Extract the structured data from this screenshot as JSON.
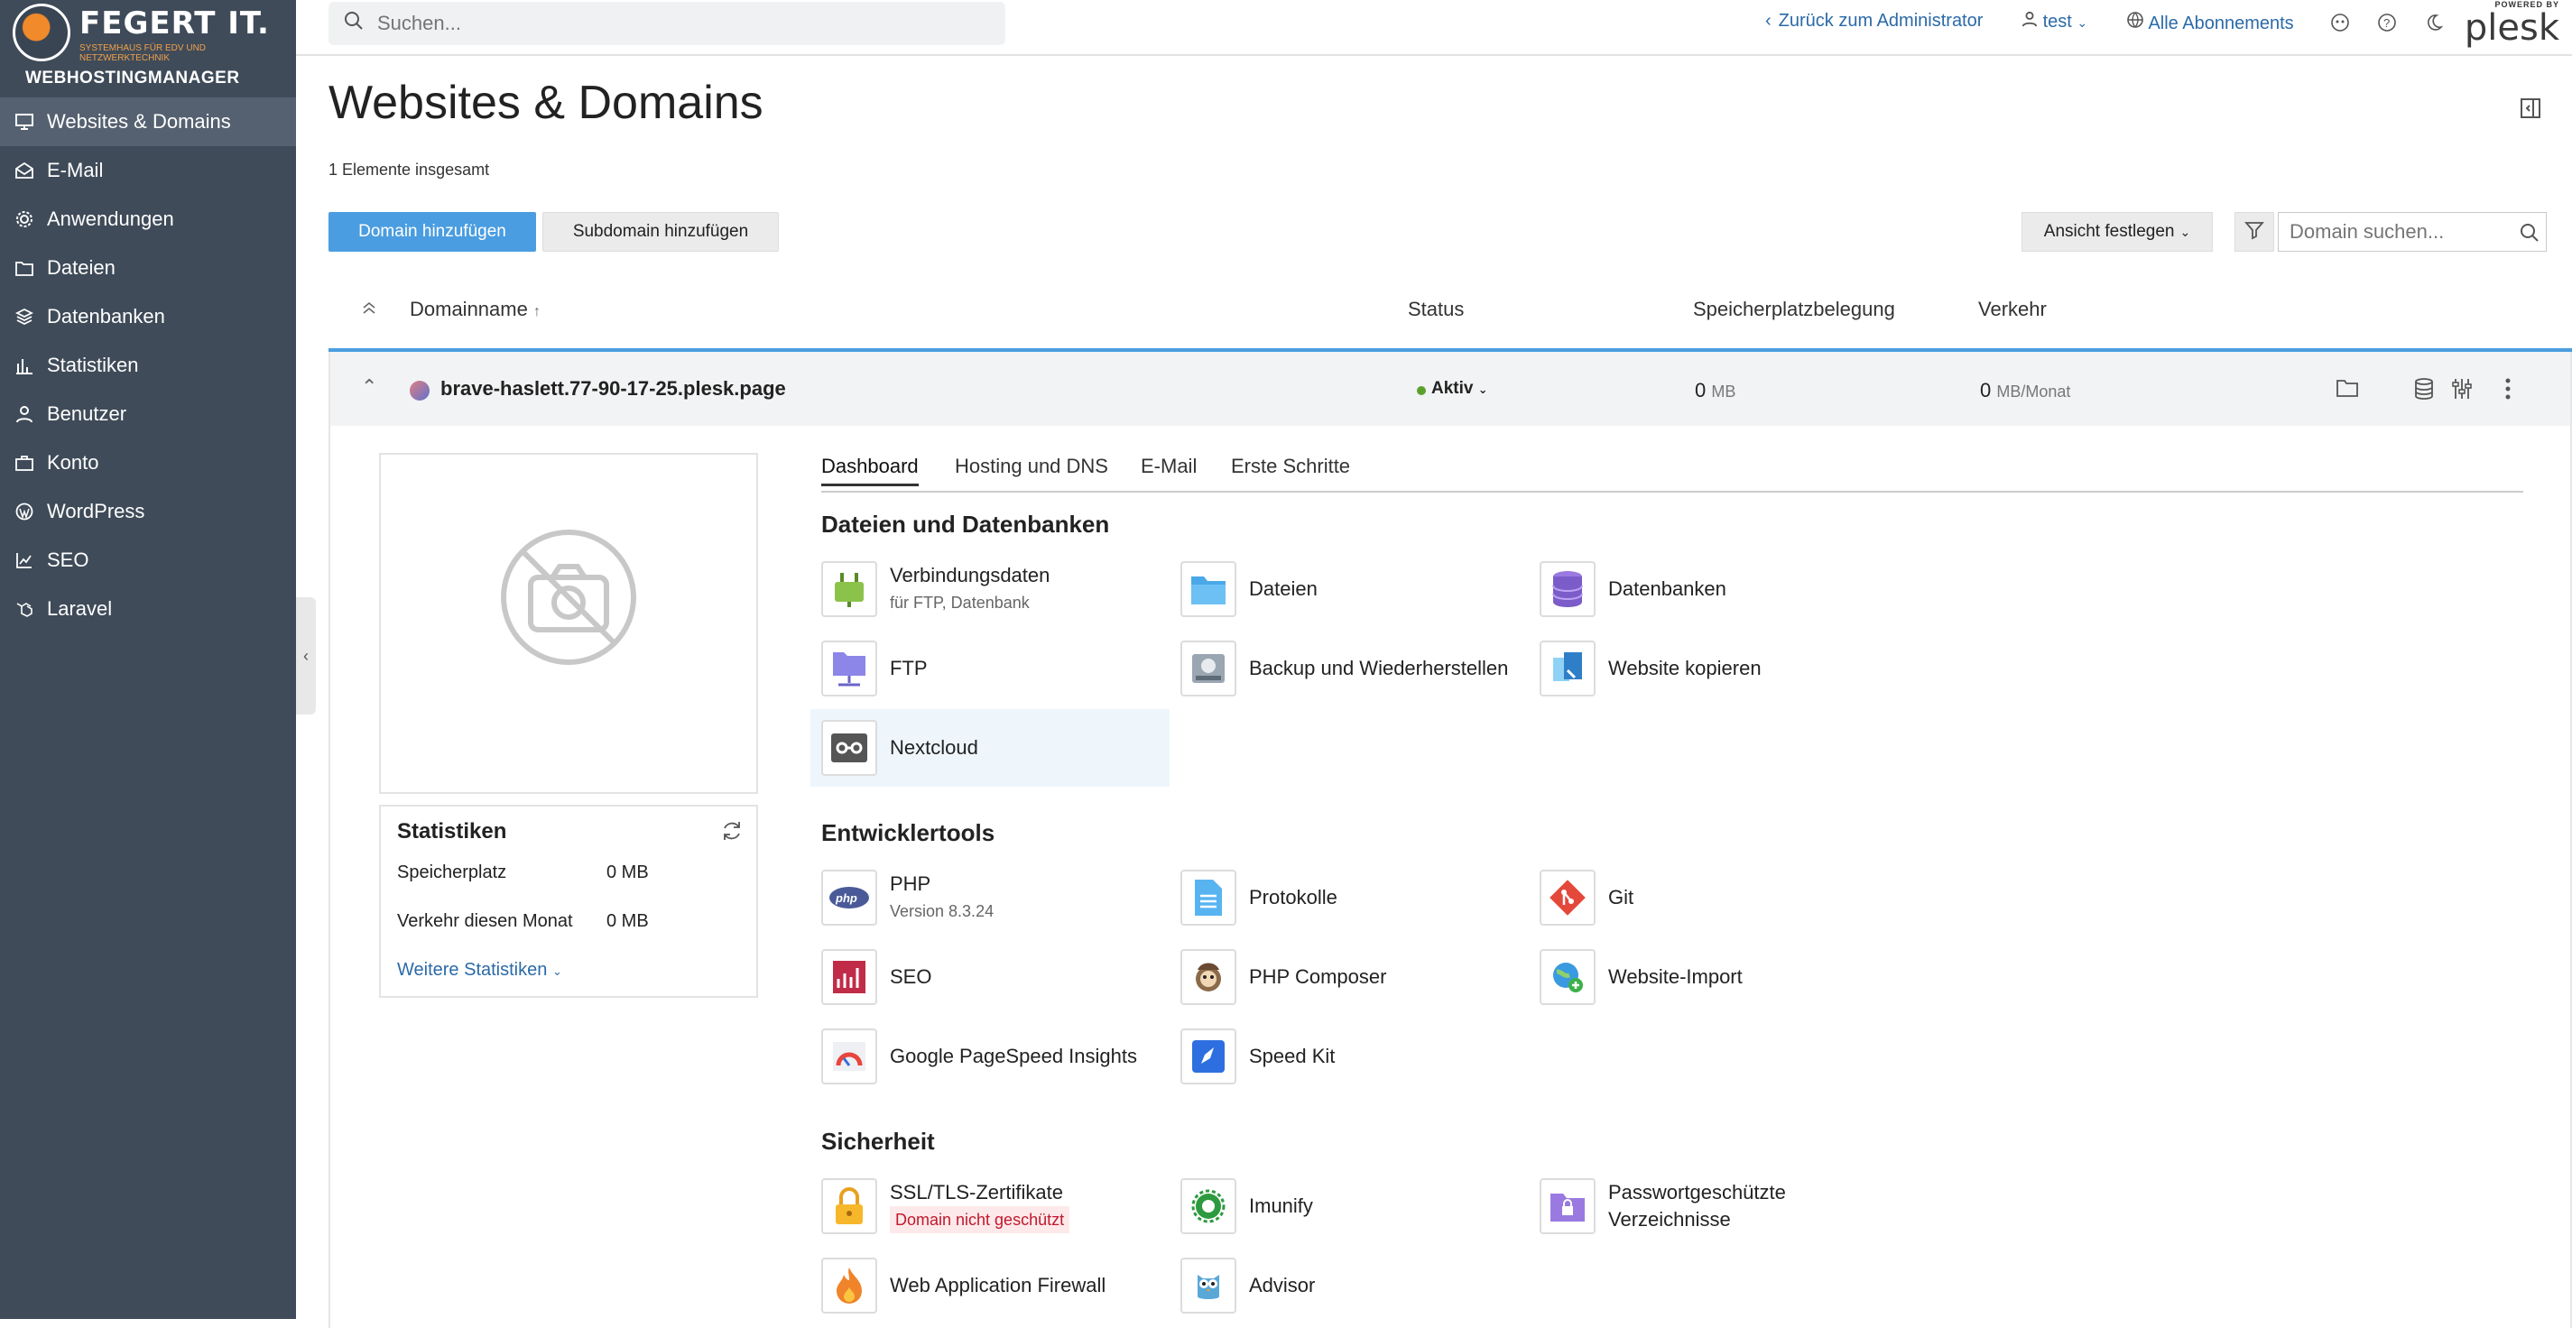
{
  "brand": {
    "title": "FEGERT IT.",
    "subtitle": "SYSTEMHAUS FÜR EDV UND NETZWERKTECHNIK",
    "name": "WEBHOSTINGMANAGER"
  },
  "sidebar": {
    "items": [
      {
        "label": "Websites & Domains",
        "icon": "monitor-icon"
      },
      {
        "label": "E-Mail",
        "icon": "mail-icon"
      },
      {
        "label": "Anwendungen",
        "icon": "gear-icon"
      },
      {
        "label": "Dateien",
        "icon": "folder-icon"
      },
      {
        "label": "Datenbanken",
        "icon": "layers-icon"
      },
      {
        "label": "Statistiken",
        "icon": "bar-chart-icon"
      },
      {
        "label": "Benutzer",
        "icon": "user-icon"
      },
      {
        "label": "Konto",
        "icon": "briefcase-icon"
      },
      {
        "label": "WordPress",
        "icon": "wordpress-icon"
      },
      {
        "label": "SEO",
        "icon": "trend-icon"
      },
      {
        "label": "Laravel",
        "icon": "laravel-icon"
      }
    ]
  },
  "topbar": {
    "search_placeholder": "Suchen...",
    "back_link": "Zurück zum Administrator",
    "user": "test",
    "subscriptions": "Alle Abonnements",
    "powered_by": "POWERED BY",
    "plesk": "plesk"
  },
  "page": {
    "title": "Websites & Domains",
    "count": "1 Elemente insgesamt",
    "add_domain": "Domain hinzufügen",
    "add_subdomain": "Subdomain hinzufügen",
    "view": "Ansicht festlegen",
    "domain_search_placeholder": "Domain suchen..."
  },
  "table": {
    "col_domain": "Domainname",
    "sort_arrow": "↑",
    "col_status": "Status",
    "col_disk": "Speicherplatzbelegung",
    "col_traffic": "Verkehr"
  },
  "domain": {
    "name": "brave-haslett.77-90-17-25.plesk.page",
    "status": "Aktiv",
    "disk_value": "0",
    "disk_unit": "MB",
    "traffic_value": "0",
    "traffic_unit": "MB/Monat"
  },
  "stats": {
    "title": "Statistiken",
    "disk_label": "Speicherplatz",
    "disk_value": "0 MB",
    "traffic_label": "Verkehr diesen Monat",
    "traffic_value": "0 MB",
    "more": "Weitere Statistiken"
  },
  "tabs": [
    "Dashboard",
    "Hosting und DNS",
    "E-Mail",
    "Erste Schritte"
  ],
  "sections": {
    "files": {
      "title": "Dateien und Datenbanken",
      "tools": [
        {
          "label": "Verbindungsdaten",
          "sub": "für FTP, Datenbank",
          "icon": "plug-icon"
        },
        {
          "label": "Dateien",
          "sub": "",
          "icon": "folder-icon"
        },
        {
          "label": "Datenbanken",
          "sub": "",
          "icon": "database-icon"
        },
        {
          "label": "FTP",
          "sub": "",
          "icon": "ftp-folder-icon"
        },
        {
          "label": "Backup und Wiederherstellen",
          "sub": "",
          "icon": "backup-icon"
        },
        {
          "label": "Website kopieren",
          "sub": "",
          "icon": "copy-icon"
        },
        {
          "label": "Nextcloud",
          "sub": "",
          "icon": "nextcloud-icon"
        }
      ]
    },
    "dev": {
      "title": "Entwicklertools",
      "tools": [
        {
          "label": "PHP",
          "sub": "Version 8.3.24",
          "icon": "php-icon"
        },
        {
          "label": "Protokolle",
          "sub": "",
          "icon": "log-file-icon"
        },
        {
          "label": "Git",
          "sub": "",
          "icon": "git-icon"
        },
        {
          "label": "SEO",
          "sub": "",
          "icon": "seo-chart-icon"
        },
        {
          "label": "PHP Composer",
          "sub": "",
          "icon": "composer-icon"
        },
        {
          "label": "Website-Import",
          "sub": "",
          "icon": "globe-import-icon"
        },
        {
          "label": "Google PageSpeed Insights",
          "sub": "",
          "icon": "gauge-icon"
        },
        {
          "label": "Speed Kit",
          "sub": "",
          "icon": "rocket-icon"
        }
      ]
    },
    "security": {
      "title": "Sicherheit",
      "tools": [
        {
          "label": "SSL/TLS-Zertifikate",
          "sub": "Domain nicht geschützt",
          "icon": "lock-icon"
        },
        {
          "label": "Imunify",
          "sub": "",
          "icon": "imunify-icon"
        },
        {
          "label": "Passwortgeschützte Verzeichnisse",
          "sub": "",
          "icon": "protected-folder-icon"
        },
        {
          "label": "Web Application Firewall",
          "sub": "",
          "icon": "flame-icon"
        },
        {
          "label": "Advisor",
          "sub": "",
          "icon": "owl-icon"
        }
      ]
    }
  },
  "colors": {
    "sidebar": "#3f4b59",
    "sidebar_active": "#556170",
    "primary": "#4a9de0",
    "link": "#2b6aa8",
    "status_green": "#5aa02c",
    "warning_red": "#c0182c"
  }
}
